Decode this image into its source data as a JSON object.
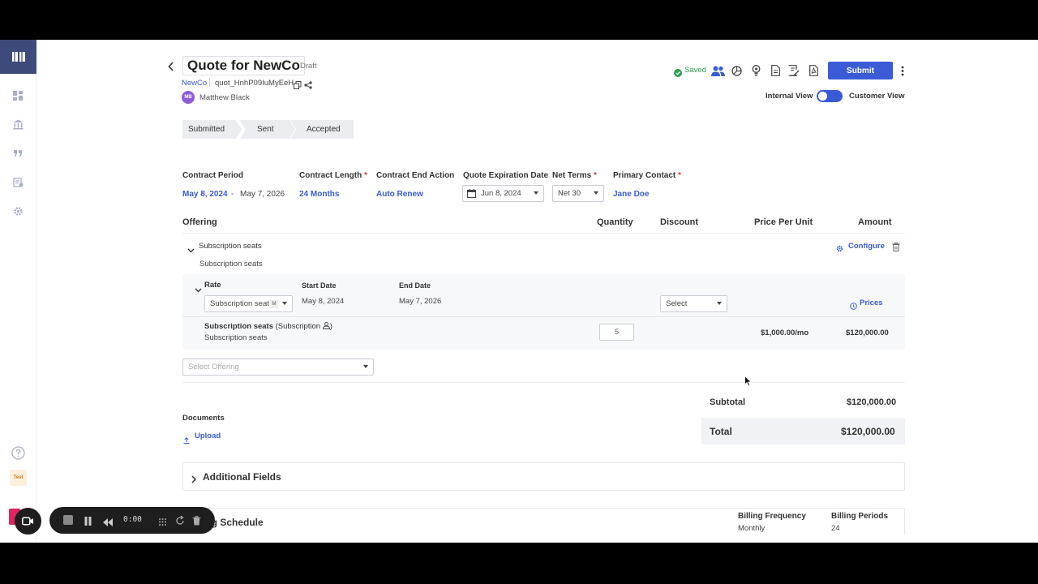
{
  "header": {
    "title": "Quote for NewCo",
    "status": "Draft",
    "company": "NewCo",
    "quote_id": "quot_HnhP09IuMyEeH",
    "owner_initials": "MB",
    "owner_name": "Matthew Black",
    "saved_label": "Saved",
    "submit_label": "Submit",
    "internal_view_label": "Internal View",
    "customer_view_label": "Customer View"
  },
  "steps": [
    "Submitted",
    "Sent",
    "Accepted"
  ],
  "contract": {
    "period_label": "Contract Period",
    "period_start": "May 8, 2024",
    "period_sep": "-",
    "period_end": "May 7, 2026",
    "length_label": "Contract Length",
    "length_value": "24 Months",
    "end_action_label": "Contract End Action",
    "end_action_value": "Auto Renew",
    "expiration_label": "Quote Expiration Date",
    "expiration_value": "Jun 8, 2024",
    "net_terms_label": "Net Terms",
    "net_terms_value": "Net 30",
    "contact_label": "Primary Contact",
    "contact_value": "Jane Doe",
    "required_mark": "*"
  },
  "table": {
    "headers": {
      "offering": "Offering",
      "quantity": "Quantity",
      "discount": "Discount",
      "price": "Price Per Unit",
      "amount": "Amount"
    },
    "group_name": "Subscription seats",
    "group_sub": "Subscription seats",
    "configure_label": "Configure",
    "rate_label": "Rate",
    "start_date_label": "Start Date",
    "end_date_label": "End Date",
    "rate_select": "Subscription seat",
    "rate_badge": "M",
    "start_date": "May 8, 2024",
    "end_date": "May 7, 2026",
    "discount_select": "Select",
    "prices_label": "Prices",
    "item_name": "Subscription seats",
    "item_type_open": "(Subscription",
    "item_type_close": ")",
    "item_sub": "Subscription seats",
    "quantity": "5",
    "price": "$1,000.00/mo",
    "amount": "$120,000.00",
    "select_offering_placeholder": "Select Offering"
  },
  "totals": {
    "subtotal_label": "Subtotal",
    "subtotal_value": "$120,000.00",
    "total_label": "Total",
    "total_value": "$120,000.00"
  },
  "documents": {
    "label": "Documents",
    "upload_label": "Upload"
  },
  "additional_fields": {
    "label": "Additional Fields"
  },
  "billing": {
    "label": "ing Schedule",
    "frequency_label": "Billing Frequency",
    "frequency_value": "Monthly",
    "periods_label": "Billing Periods",
    "periods_value": "24"
  },
  "sidebar": {
    "test_badge": "Test"
  },
  "recorder": {
    "time": "0:00"
  },
  "colors": {
    "accent": "#3b5bd6",
    "sidebar_logo": "#3d4a7a",
    "saved_green": "#2e9e4f",
    "required": "#d4403a"
  }
}
